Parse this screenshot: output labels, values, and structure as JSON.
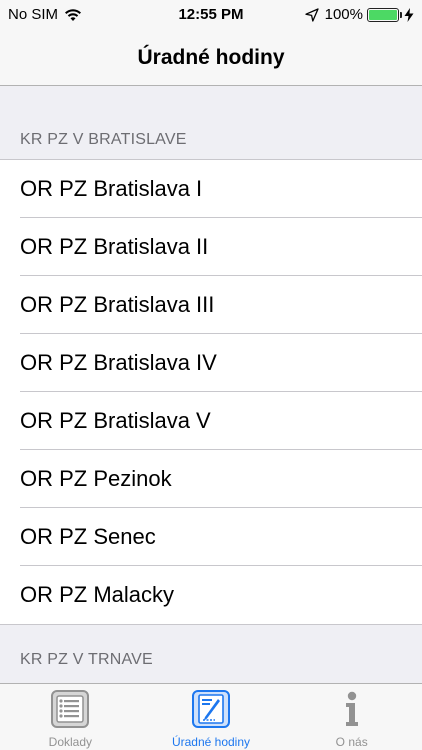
{
  "status_bar": {
    "carrier": "No SIM",
    "time": "12:55 PM",
    "battery_percent": "100%",
    "battery_level": 1.0,
    "icons": [
      "wifi-icon",
      "location-arrow-icon",
      "battery-icon",
      "charging-bolt-icon"
    ]
  },
  "nav": {
    "title": "Úradné hodiny"
  },
  "sections": [
    {
      "header": "KR PZ V BRATISLAVE",
      "items": [
        "OR PZ Bratislava I",
        "OR PZ Bratislava II",
        "OR PZ Bratislava III",
        "OR PZ Bratislava IV",
        "OR PZ Bratislava V",
        "OR PZ Pezinok",
        "OR PZ Senec",
        "OR PZ Malacky"
      ]
    },
    {
      "header": "KR PZ V TRNAVE",
      "items": []
    }
  ],
  "tab_bar": {
    "tabs": [
      {
        "label": "Doklady",
        "icon": "list-document-icon",
        "active": false
      },
      {
        "label": "Úradné hodiny",
        "icon": "document-edit-icon",
        "active": true
      },
      {
        "label": "O nás",
        "icon": "info-icon",
        "active": false
      }
    ]
  },
  "colors": {
    "accent": "#1d77ef",
    "battery": "#4cd964",
    "background": "#efeff4"
  }
}
